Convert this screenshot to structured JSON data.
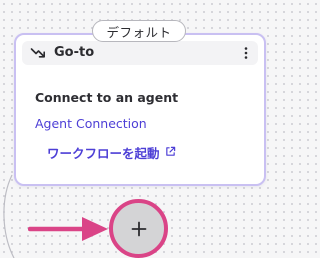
{
  "node": {
    "tag": "デフォルト",
    "title": "Go-to",
    "title_icon": "goto-arrow-icon",
    "menu_icon": "more-vertical-icon",
    "subtitle": "Connect to an agent",
    "agent_link": "Agent Connection",
    "workflow_link": "ワークフローを起動",
    "workflow_link_icon": "external-link-icon"
  },
  "add_button": {
    "icon": "plus-icon",
    "glyph": "+"
  },
  "colors": {
    "accent": "#4d3fd6",
    "card_border": "#c9c0f2",
    "highlight": "#da4487",
    "canvas": "#f6f6f7"
  }
}
